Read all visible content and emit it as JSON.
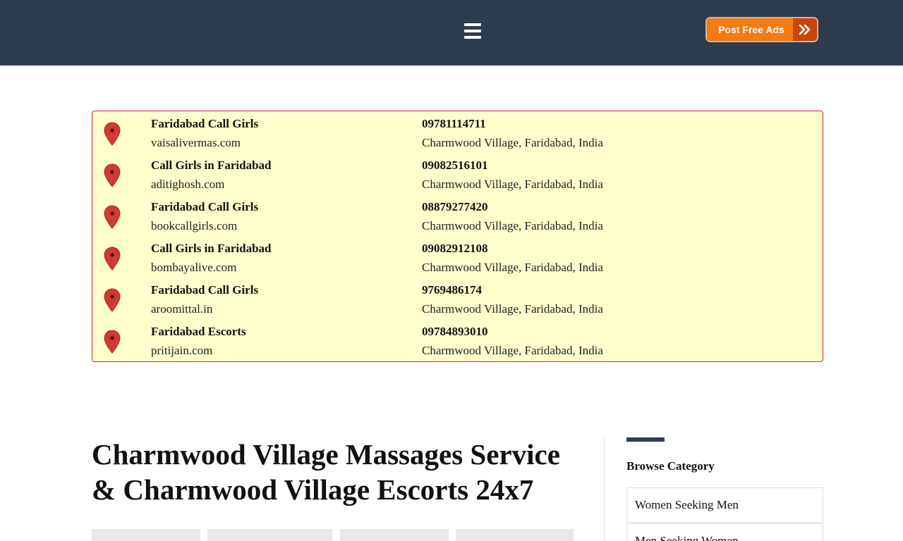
{
  "header": {
    "menu_icon": "hamburger-icon",
    "post_button_label": "Post Free Ads",
    "post_button_icon": "double-chevron-right-icon",
    "colors": {
      "bar": "#2e3c4f",
      "button": "#f37b14",
      "button_arrow": "#c8450c"
    }
  },
  "listings": [
    {
      "name": "Faridabad Call Girls",
      "site": "vaisalivermas.com",
      "phone": "09781114711",
      "location": "Charmwood Village, Faridabad, India"
    },
    {
      "name": "Call Girls in Faridabad",
      "site": "aditighosh.com",
      "phone": "09082516101",
      "location": "Charmwood Village, Faridabad, India"
    },
    {
      "name": "Faridabad Call Girls",
      "site": "bookcallgirls.com",
      "phone": "08879277420",
      "location": "Charmwood Village, Faridabad, India"
    },
    {
      "name": "Call Girls in Faridabad",
      "site": "bombayalive.com",
      "phone": "09082912108",
      "location": "Charmwood Village, Faridabad, India"
    },
    {
      "name": "Faridabad Call Girls",
      "site": "aroomittal.in",
      "phone": "9769486174",
      "location": "Charmwood Village, Faridabad, India"
    },
    {
      "name": "Faridabad Escorts",
      "site": "pritijain.com",
      "phone": "09784893010",
      "location": "Charmwood Village, Faridabad, India"
    }
  ],
  "listing_box_colors": {
    "background": "#ffffcc",
    "border": "#dd2233",
    "pin": "#d03a2f"
  },
  "main": {
    "title_line1": "Charmwood Village Massages Service",
    "title_line2": "& Charmwood Village Escorts 24x7"
  },
  "sidebar": {
    "heading": "Browse Category",
    "categories": [
      "Women Seeking Men",
      "Men Seeking Women"
    ]
  }
}
